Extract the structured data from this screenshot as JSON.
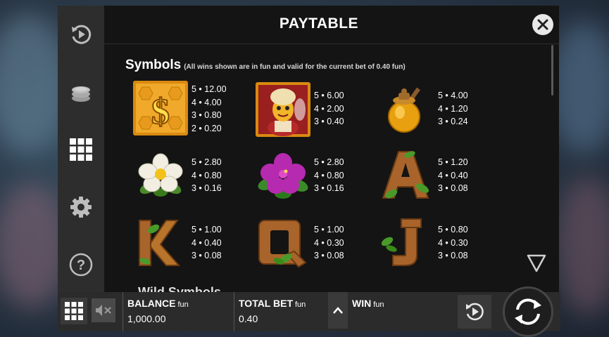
{
  "panel": {
    "title": "PAYTABLE"
  },
  "section": {
    "title": "Symbols",
    "note": "(All wins shown are in fun and valid for the current bet of 0.40 fun)",
    "next_title": "Wild Symbols"
  },
  "symbols": [
    {
      "name": "dollar",
      "pays": [
        "5 • 12.00",
        "4 • 4.00",
        "3 • 0.80",
        "2 • 0.20"
      ]
    },
    {
      "name": "queen-bee",
      "pays": [
        "5 • 6.00",
        "4 • 2.00",
        "3 • 0.40"
      ]
    },
    {
      "name": "honey-pot",
      "pays": [
        "5 • 4.00",
        "4 • 1.20",
        "3 • 0.24"
      ]
    },
    {
      "name": "white-flower",
      "pays": [
        "5 • 2.80",
        "4 • 0.80",
        "3 • 0.16"
      ]
    },
    {
      "name": "purple-flower",
      "pays": [
        "5 • 2.80",
        "4 • 0.80",
        "3 • 0.16"
      ]
    },
    {
      "name": "letter-a",
      "pays": [
        "5 • 1.20",
        "4 • 0.40",
        "3 • 0.08"
      ]
    },
    {
      "name": "letter-k",
      "pays": [
        "5 • 1.00",
        "4 • 0.40",
        "3 • 0.08"
      ]
    },
    {
      "name": "letter-q",
      "pays": [
        "5 • 1.00",
        "4 • 0.30",
        "3 • 0.08"
      ]
    },
    {
      "name": "letter-j",
      "pays": [
        "5 • 0.80",
        "4 • 0.30",
        "3 • 0.08"
      ]
    }
  ],
  "bottom": {
    "balance_label": "BALANCE",
    "balance_unit": "fun",
    "balance_value": "1,000.00",
    "bet_label": "TOTAL BET",
    "bet_unit": "fun",
    "bet_value": "0.40",
    "win_label": "WIN",
    "win_unit": "fun"
  },
  "icons": {
    "sidebar": [
      "replay-icon",
      "coins-icon",
      "grid-icon",
      "gear-icon",
      "help-icon"
    ],
    "accent": "#f5b21a"
  }
}
